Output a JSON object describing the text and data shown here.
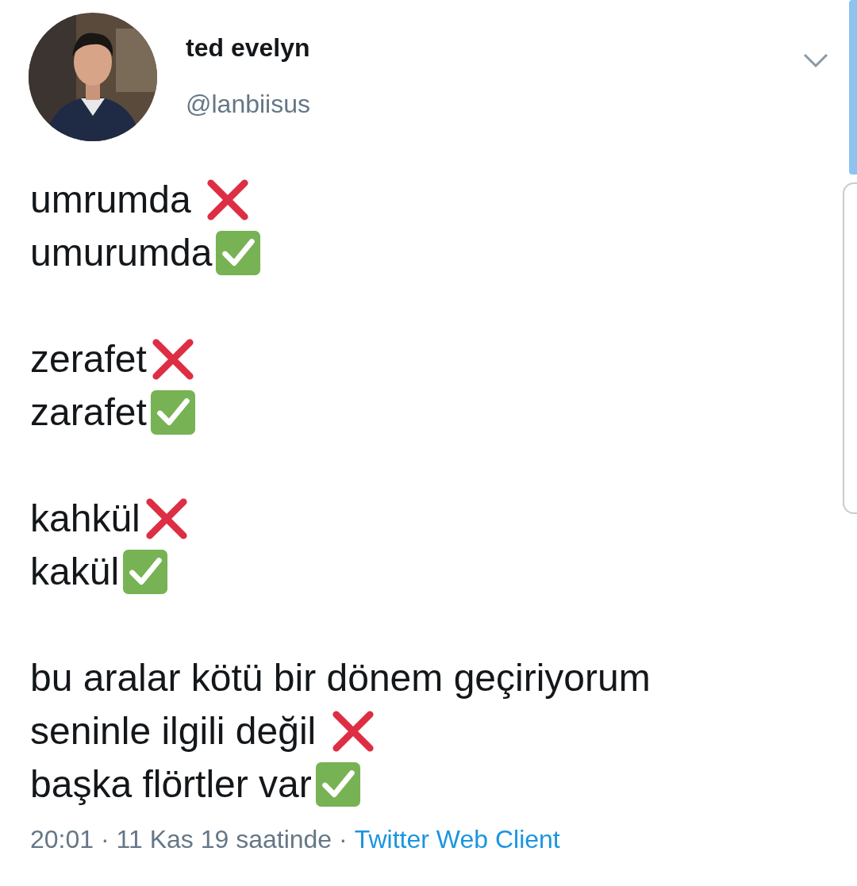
{
  "author": {
    "name": "ted evelyn",
    "handle": "@lanbiisus"
  },
  "paragraphs": [
    [
      {
        "text": "umrumda ",
        "kind": "cross"
      },
      {
        "text": "umurumda",
        "kind": "check"
      }
    ],
    [
      {
        "text": "zerafet",
        "kind": "cross"
      },
      {
        "text": "zarafet",
        "kind": "check"
      }
    ],
    [
      {
        "text": "kahkül",
        "kind": "cross"
      },
      {
        "text": "kakül",
        "kind": "check"
      }
    ],
    [
      {
        "text": "bu aralar kötü bir dönem geçiriyorum",
        "kind": "plain"
      },
      {
        "text": "seninle ilgili değil ",
        "kind": "cross"
      },
      {
        "text": "başka flörtler var",
        "kind": "check"
      }
    ]
  ],
  "footer": {
    "time": "20:01 · 11 Kas 19 saatinde ·",
    "client": "Twitter Web Client"
  }
}
